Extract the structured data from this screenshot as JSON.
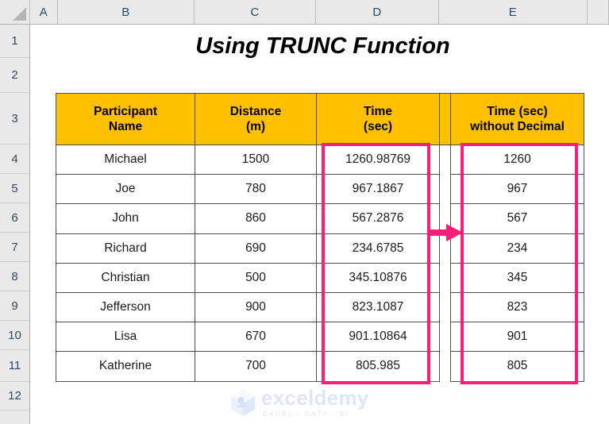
{
  "title": "Using TRUNC Function",
  "spreadsheet": {
    "column_headers": [
      "A",
      "B",
      "C",
      "D",
      "E"
    ],
    "row_headers": [
      "1",
      "2",
      "3",
      "4",
      "5",
      "6",
      "7",
      "8",
      "9",
      "10",
      "11",
      "12"
    ],
    "select_all_corner": "select-all-triangle"
  },
  "table": {
    "headers": {
      "name_line1": "Participant",
      "name_line2": "Name",
      "distance_line1": "Distance",
      "distance_line2": "(m)",
      "time_line1": "Time",
      "time_line2": "(sec)",
      "trunc_line1": "Time (sec)",
      "trunc_line2": "without Decimal"
    },
    "rows": [
      {
        "name": "Michael",
        "distance": "1500",
        "time": "1260.98769",
        "trunc": "1260"
      },
      {
        "name": "Joe",
        "distance": "780",
        "time": "967.1867",
        "trunc": "967"
      },
      {
        "name": "John",
        "distance": "860",
        "time": "567.2876",
        "trunc": "567"
      },
      {
        "name": "Richard",
        "distance": "690",
        "time": "234.6785",
        "trunc": "234"
      },
      {
        "name": "Christian",
        "distance": "500",
        "time": "345.10876",
        "trunc": "345"
      },
      {
        "name": "Jefferson",
        "distance": "900",
        "time": "823.1087",
        "trunc": "823"
      },
      {
        "name": "Lisa",
        "distance": "670",
        "time": "901.10864",
        "trunc": "901"
      },
      {
        "name": "Katherine",
        "distance": "700",
        "time": "805.985",
        "trunc": "805"
      }
    ]
  },
  "annotations": {
    "highlight_color": "#FA1E78",
    "header_fill_color": "#FFC000",
    "arrow": "right-arrow-icon",
    "highlight_time_column": "Time (sec)",
    "highlight_trunc_column": "Time (sec) without Decimal"
  },
  "watermark": {
    "brand": "exceldemy",
    "tagline": "EXCEL - DATA - BI",
    "logo": "exceldemy-cube-logo"
  }
}
